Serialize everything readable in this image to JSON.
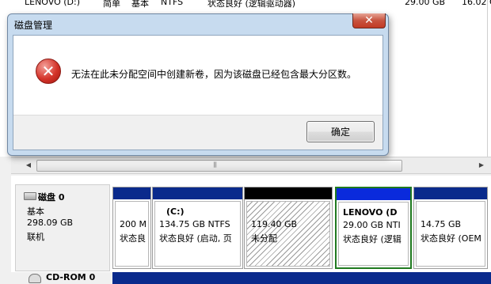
{
  "background_list": {
    "row": [
      "LENOVO (D:)",
      "简单",
      "基本",
      "NTFS",
      "状态良好 (逻辑驱动器)",
      "29.00 GB",
      "16.02 G"
    ]
  },
  "scrollbar": {
    "left_arrow": "◀",
    "right_arrow": "▶",
    "grip": "|||"
  },
  "disk0": {
    "name": "磁盘 0",
    "type": "基本",
    "size": "298.09 GB",
    "status": "联机",
    "partitions": [
      {
        "line1": "",
        "line2": "200 M",
        "line3": "状态良",
        "bar_color": "#0a2a8c"
      },
      {
        "line1": "(C:)",
        "line2": "134.75 GB NTFS",
        "line3": "状态良好 (启动, 页",
        "bar_color": "#0a2a8c"
      },
      {
        "line1": "",
        "line2": "119.40 GB",
        "line3": "未分配",
        "bar_color": "#000000"
      },
      {
        "line1": "LENOVO  (D",
        "line2": "29.00 GB NTI",
        "line3": "状态良好 (逻辑",
        "bar_color": "#0a2adc"
      },
      {
        "line1": "",
        "line2": "14.75 GB",
        "line3": "状态良好 (OEM",
        "bar_color": "#0a2a8c"
      }
    ]
  },
  "disk1": {
    "name": "CD-ROM 0"
  },
  "dialog": {
    "title": "磁盘管理",
    "close_glyph": "✕",
    "message": "无法在此未分配空间中创建新卷，因为该磁盘已经包含最大分区数。",
    "ok_label": "确定",
    "icon": "error-icon",
    "icon_glyph": "✕"
  }
}
